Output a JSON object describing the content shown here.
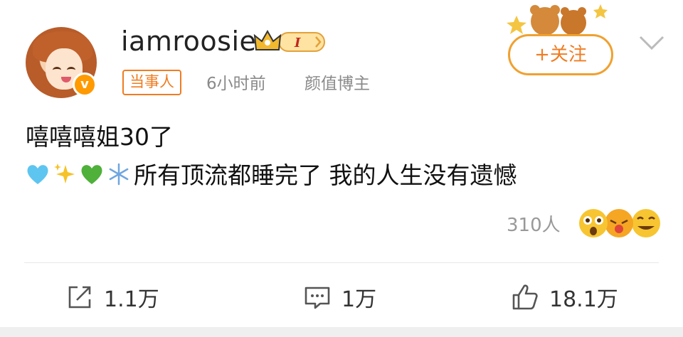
{
  "user": {
    "name": "iamroosie",
    "verified_symbol": "v",
    "level_label": "I",
    "tag": "当事人",
    "time": "6小时前",
    "description": "颜值博主"
  },
  "follow": {
    "label": "+关注"
  },
  "post": {
    "line1": "嘻嘻嘻姐30了",
    "line2_text": "所有顶流都睡完了 我的人生没有遗憾",
    "line2_emojis": [
      "blue-heart",
      "sparkles",
      "green-heart",
      "snowflake"
    ]
  },
  "reactions": {
    "count_label": "310人"
  },
  "actions": {
    "share": "1.1万",
    "comment": "1万",
    "like": "18.1万"
  },
  "colors": {
    "accent": "#f07c21",
    "muted": "#8a8a8a"
  }
}
